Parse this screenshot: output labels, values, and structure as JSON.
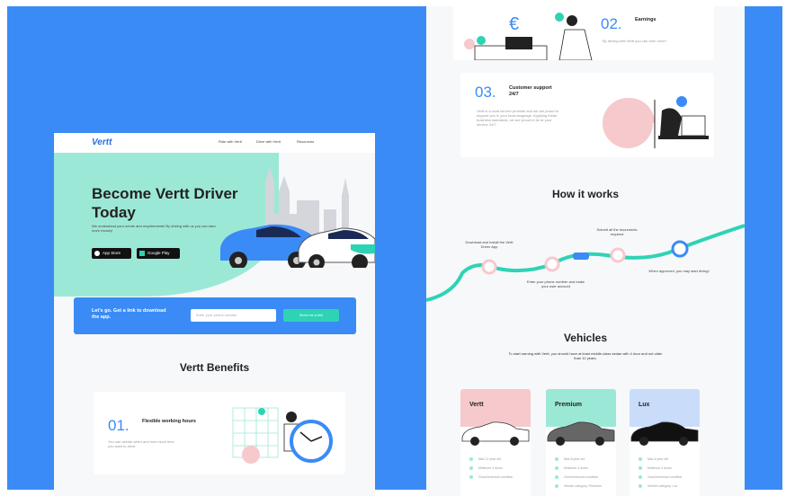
{
  "left_page": {
    "nav": {
      "logo": "Vertt",
      "links": [
        "Ride with Vertt",
        "Drive with Vertt",
        "Resources"
      ]
    },
    "hero": {
      "title": "Become Vertt Driver Today",
      "subtitle": "We understand your needs and requirements! By driving with us you can earn more money!",
      "app_store": "App Store",
      "google_play": "Google Play"
    },
    "cta": {
      "text": "Let's go. Get a link to download the app.",
      "placeholder": "Enter your phone number",
      "button": "Send me a link"
    },
    "benefits": {
      "heading": "Vertt Benefits",
      "item1": {
        "num": "01.",
        "title": "Flexible working hours",
        "desc": "You can decide when and how much time you want to drive."
      }
    }
  },
  "right_page": {
    "earnings": {
      "num": "02.",
      "title": "Earnings",
      "desc": "By driving with Vertt you can earn more!"
    },
    "support": {
      "num": "03.",
      "title": "Customer support 24/7",
      "desc": "Vertt is a local service provider and we are proud to support you in your local language. Applying these business standards, we are proud to be at your service 24/7."
    },
    "how": {
      "heading": "How it works",
      "steps": [
        "Download and install the Vertt Driver App",
        "Enter your phone number and make your user account",
        "Submit all the documents required",
        "When approved, you may start diving!"
      ]
    },
    "vehicles": {
      "heading": "Vehicles",
      "subtitle": "To start earning with Vertt, you should have at least middle-class sedan with 4 door and not older than 12 years.",
      "cards": [
        {
          "name": "Vertt",
          "color": "#f6c9cd",
          "checks": [
            "Max 12 year old",
            "Minimum 4 doors",
            "Good technical condition"
          ]
        },
        {
          "name": "Premium",
          "color": "#9ce8d6",
          "checks": [
            "Max 8 year old",
            "Minimum 4 doors",
            "Good technical condition",
            "Vehicle category: Premium"
          ]
        },
        {
          "name": "Lux",
          "color": "#c9dcfa",
          "checks": [
            "Max 6 year old",
            "Minimum 4 doors",
            "Good technical condition",
            "Vehicle category: Lux"
          ]
        }
      ]
    }
  },
  "colors": {
    "brand_blue": "#3a8bf6",
    "mint": "#2ed3b5",
    "pink": "#f6c9cd"
  }
}
